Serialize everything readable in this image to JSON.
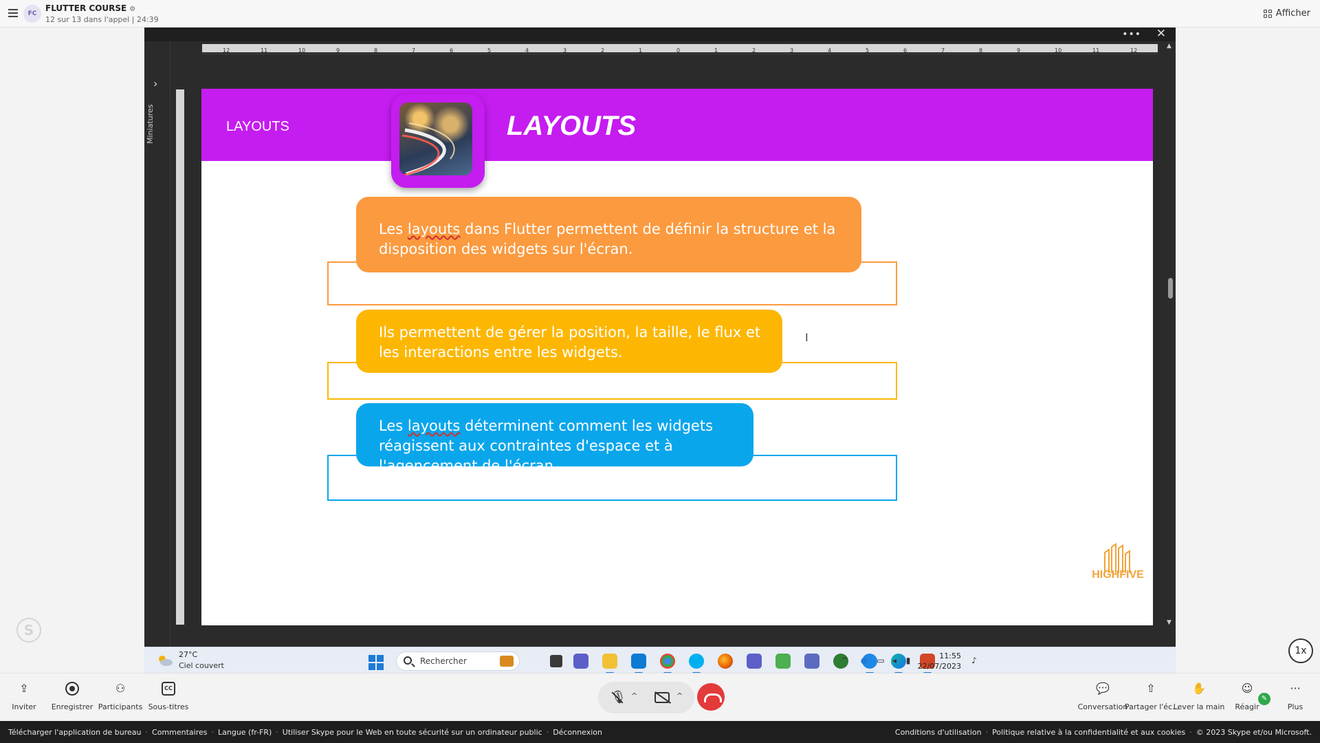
{
  "header": {
    "avatar_initials": "FC",
    "call_title": "FLUTTER COURSE",
    "call_subtitle": "12 sur 13 dans l'appel | 24:39",
    "view_button": "Afficher"
  },
  "share": {
    "pane_label": "Miniatures",
    "slide": {
      "band_label": "LAYOUTS",
      "title": "LAYOUTS",
      "boxes": [
        {
          "pre": "Les ",
          "underlined": "layouts",
          "post": " dans Flutter permettent de définir la structure et la disposition des widgets sur l'écran.",
          "color": "#fb9a3f"
        },
        {
          "pre": "Ils permettent de gérer la position, la taille, le flux et les interactions entre les widgets.",
          "underlined": "",
          "post": "",
          "color": "#fdb702"
        },
        {
          "pre": "Les ",
          "underlined": "layouts",
          "post": " déterminent comment les widgets réagissent aux contraintes d'espace et à l'agencement de l'écran.",
          "color": "#0aa6ec"
        }
      ],
      "logo_text": "HIGHFIVE",
      "accent": "#c51cf0"
    },
    "taskbar": {
      "weather_temp": "27°C",
      "weather_desc": "Ciel couvert",
      "search_placeholder": "Rechercher",
      "time": "11:55",
      "date": "22/07/2023"
    },
    "playback_speed": "1x"
  },
  "controls": {
    "left": [
      {
        "label": "Inviter",
        "icon": "share-upload-icon"
      },
      {
        "label": "Enregistrer",
        "icon": "record-icon"
      },
      {
        "label": "Participants",
        "icon": "participants-icon"
      },
      {
        "label": "Sous-titres",
        "icon": "captions-icon"
      }
    ],
    "right": [
      {
        "label": "Conversation",
        "icon": "chat-icon"
      },
      {
        "label": "Partager l'éc...",
        "icon": "share-screen-icon"
      },
      {
        "label": "Lever la main",
        "icon": "raise-hand-icon"
      },
      {
        "label": "Réagir",
        "icon": "react-icon"
      },
      {
        "label": "Plus",
        "icon": "more-icon"
      }
    ]
  },
  "footer": {
    "left": [
      "Télécharger l'application de bureau",
      "Commentaires",
      "Langue (fr-FR)",
      "Utiliser Skype pour le Web en toute sécurité sur un ordinateur public",
      "Déconnexion"
    ],
    "right": [
      "Conditions d'utilisation",
      "Politique relative à la confidentialité et aux cookies",
      "© 2023 Skype et/ou Microsoft."
    ]
  }
}
